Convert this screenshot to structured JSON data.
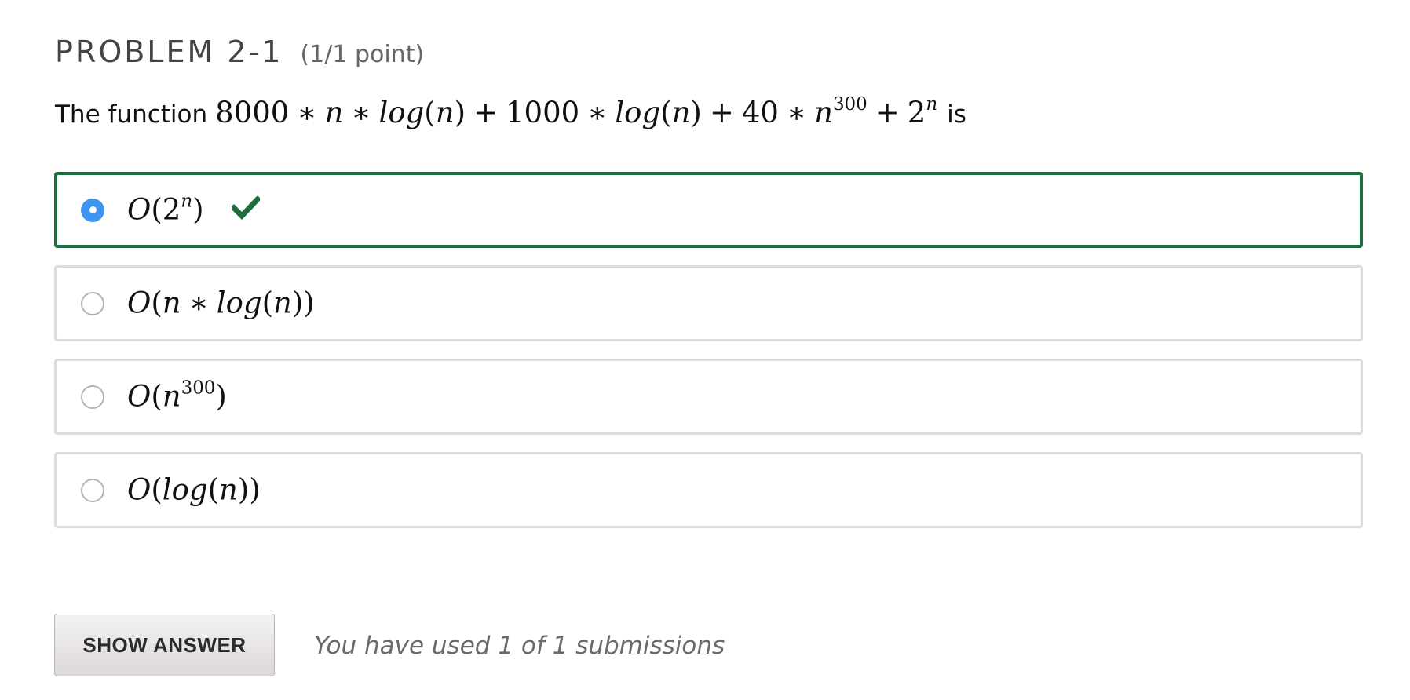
{
  "problem": {
    "title": "PROBLEM 2-1",
    "points": "(1/1 point)"
  },
  "question": {
    "lead": "The function",
    "tail": "is",
    "expression": {
      "c1": "8000",
      "times": "∗",
      "plus": "+",
      "n": "n",
      "log": "log",
      "c2": "1000",
      "c3": "40",
      "exp300": "300",
      "two": "2",
      "expn": "n"
    }
  },
  "options": [
    {
      "label": "O(2^n)",
      "selected": true,
      "status": "correct"
    },
    {
      "label": "O(n * log(n))",
      "selected": false
    },
    {
      "label": "O(n^300)",
      "selected": false
    },
    {
      "label": "O(log(n))",
      "selected": false
    }
  ],
  "math_parts": {
    "O": "O",
    "lp": "(",
    "rp": ")",
    "two": "2",
    "n": "n",
    "exp300": "300",
    "log": "log",
    "times": "∗"
  },
  "icons": {
    "correct": "checkmark-icon",
    "radio_selected": "radio-selected-icon",
    "radio_unselected": "radio-unselected-icon"
  },
  "colors": {
    "correct_border": "#1d6e3c",
    "checkmark": "#1d6e3c",
    "radio_selected": "#3d95ef",
    "option_border": "#dcdcdc"
  },
  "actions": {
    "show_answer": "SHOW ANSWER",
    "submissions_text": "You have used 1 of 1 submissions"
  }
}
